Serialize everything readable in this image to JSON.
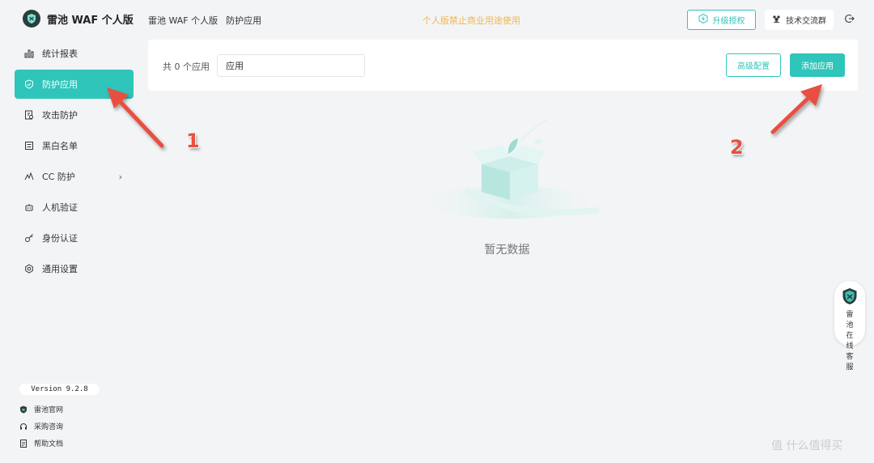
{
  "app": {
    "name": "雷池 WAF 个人版",
    "version": "Version 9.2.8"
  },
  "header": {
    "breadcrumb": [
      "雷池 WAF 个人版",
      "防护应用"
    ],
    "notice": "个人版禁止商业用途使用",
    "upgrade_label": "升级授权",
    "group_label": "技术交流群"
  },
  "sidebar": {
    "items": [
      {
        "label": "统计报表",
        "icon": "bar-chart-icon"
      },
      {
        "label": "防护应用",
        "icon": "shield-icon",
        "active": true
      },
      {
        "label": "攻击防护",
        "icon": "document-shield-icon"
      },
      {
        "label": "黑白名单",
        "icon": "list-icon"
      },
      {
        "label": "CC 防护",
        "icon": "pulse-icon",
        "has_children": true
      },
      {
        "label": "人机验证",
        "icon": "robot-icon"
      },
      {
        "label": "身份认证",
        "icon": "key-icon"
      },
      {
        "label": "通用设置",
        "icon": "gear-icon"
      }
    ],
    "footer": [
      {
        "label": "雷池官网",
        "icon": "shield-logo-icon"
      },
      {
        "label": "采购咨询",
        "icon": "headset-icon"
      },
      {
        "label": "帮助文档",
        "icon": "document-icon"
      }
    ]
  },
  "toolbar": {
    "count_text": "共 0 个应用",
    "search_value": "应用",
    "advanced_label": "高级配置",
    "add_label": "添加应用"
  },
  "empty": {
    "text": "暂无数据"
  },
  "support": {
    "label": "雷池在线客服"
  },
  "annotations": {
    "step1": "1",
    "step2": "2",
    "arrow_color": "#e9503f"
  },
  "watermark": "值 什么值得买",
  "colors": {
    "accent": "#2fc5bb",
    "notice": "#f2b64d",
    "background": "#f3f4f6"
  }
}
